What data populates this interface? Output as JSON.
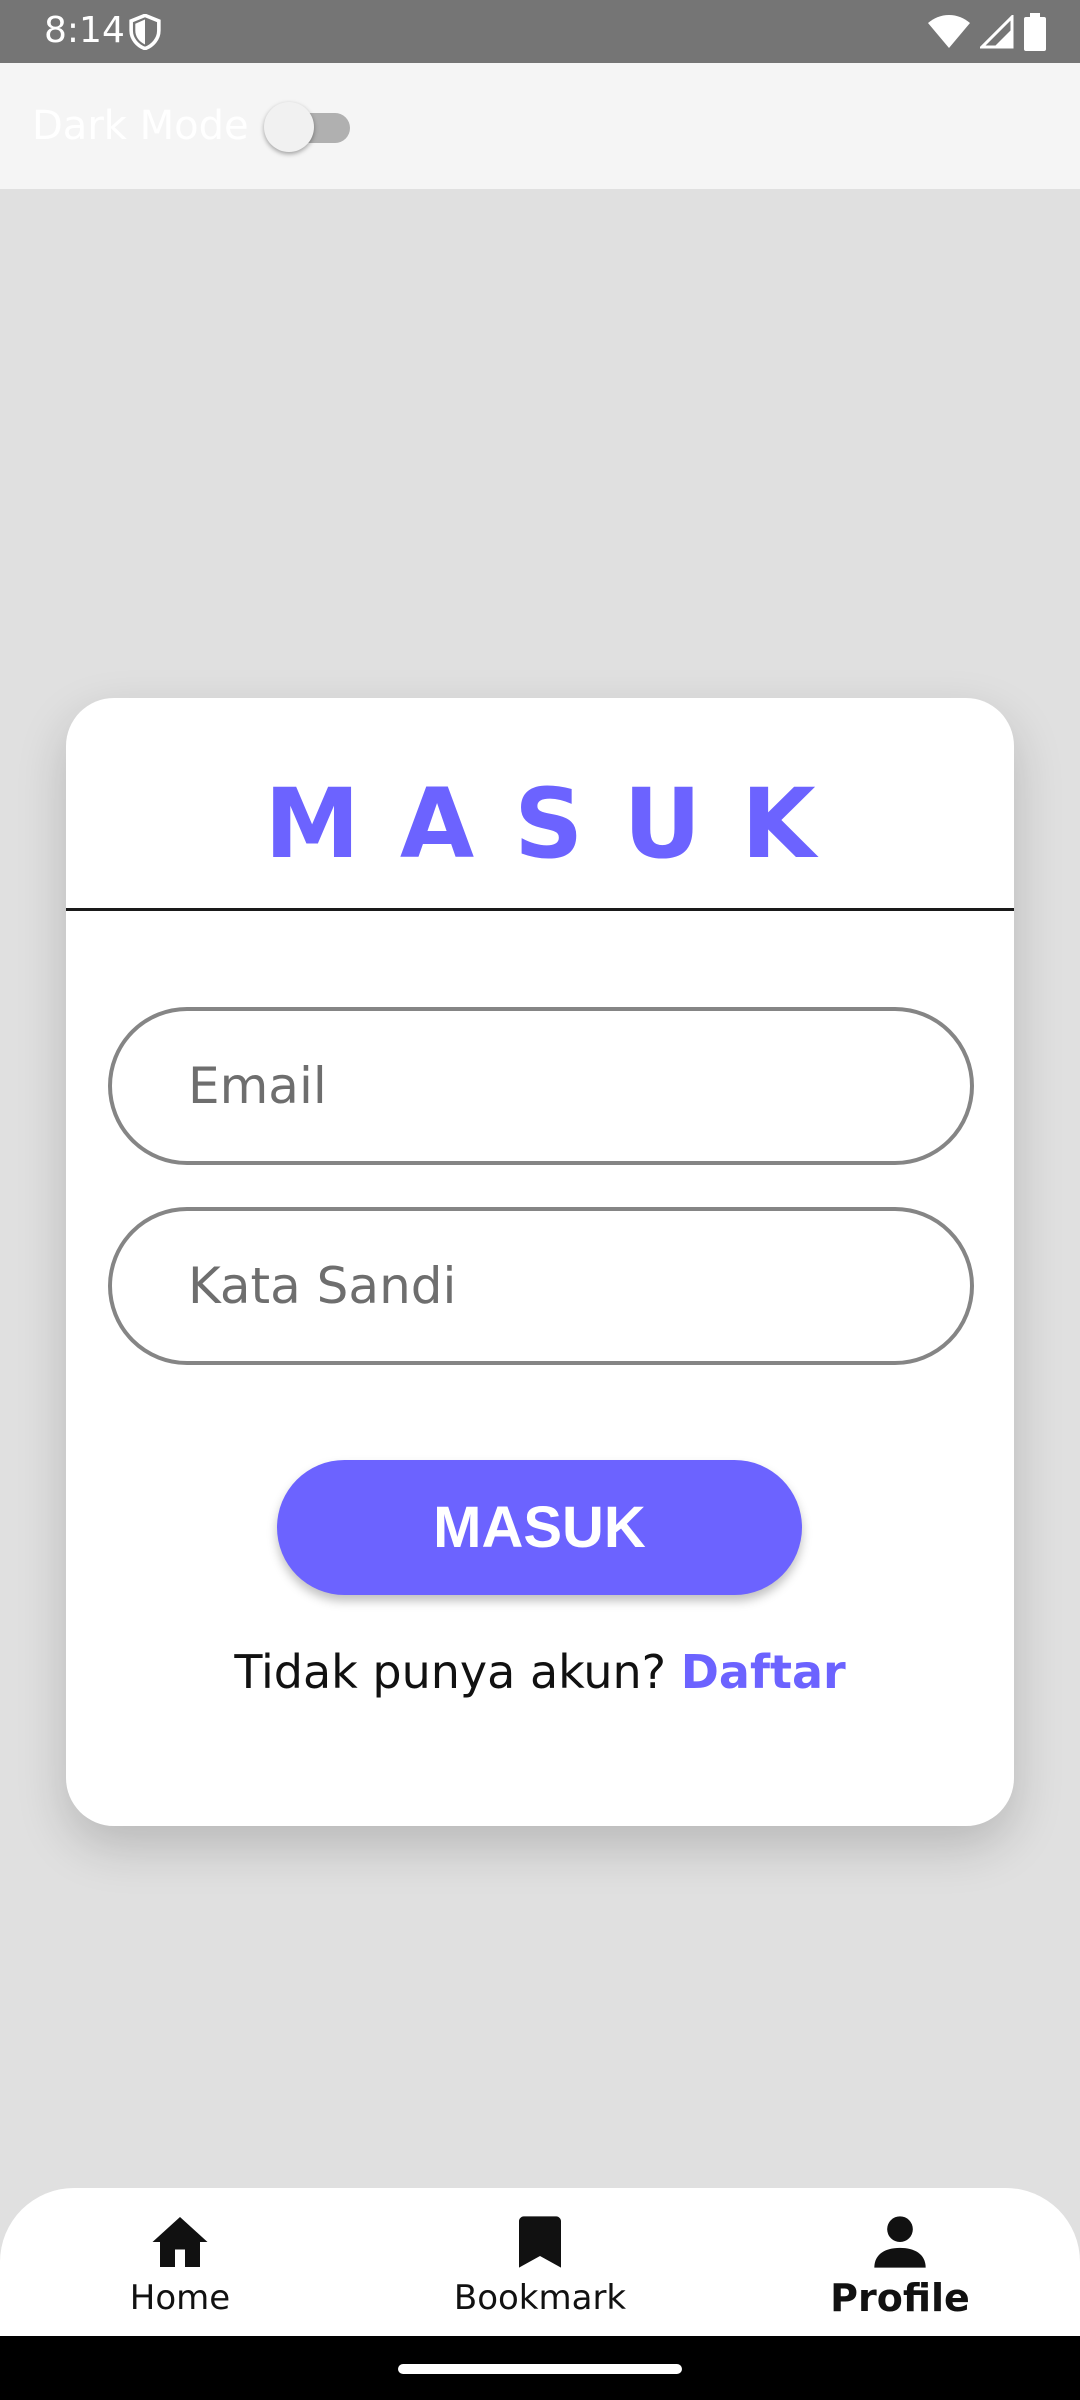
{
  "status_bar": {
    "time": "8:14",
    "icons": [
      "shield-icon",
      "wifi-icon",
      "signal-icon",
      "battery-icon"
    ]
  },
  "top_bar": {
    "dark_mode_label": "Dark Mode",
    "dark_mode_enabled": false
  },
  "login_card": {
    "title": "MASUK",
    "email_placeholder": "Email",
    "email_value": "",
    "password_placeholder": "Kata Sandi",
    "password_value": "",
    "submit_label": "MASUK",
    "register_prompt": "Tidak punya akun?",
    "register_link": "Daftar"
  },
  "bottom_nav": {
    "items": [
      {
        "label": "Home",
        "icon": "home-icon",
        "active": false
      },
      {
        "label": "Bookmark",
        "icon": "bookmark-icon",
        "active": false
      },
      {
        "label": "Profile",
        "icon": "person-icon",
        "active": true
      }
    ]
  },
  "colors": {
    "accent": "#6c63ff",
    "background": "#e0e0e0",
    "status_bar": "#757575",
    "card": "#ffffff"
  }
}
